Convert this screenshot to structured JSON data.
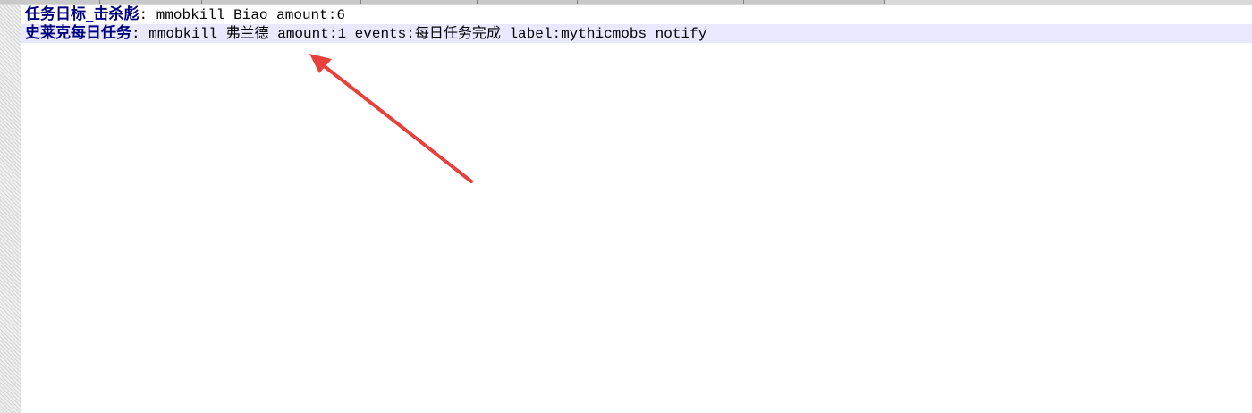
{
  "editor": {
    "lines": [
      {
        "key": "任务日标_击杀彪",
        "separator": ":",
        "value": " mmobkill Biao amount:6"
      },
      {
        "key": "史莱克每日任务",
        "separator": ":",
        "value": " mmobkill 弗兰德 amount:1 events:每日任务完成 label:mythicmobs notify"
      }
    ]
  },
  "colors": {
    "key_text": "#000080",
    "current_line_highlight": "#e8e8ff",
    "annotation_arrow": "#e8403a"
  },
  "icons": {
    "annotation": "red-arrow-icon"
  }
}
